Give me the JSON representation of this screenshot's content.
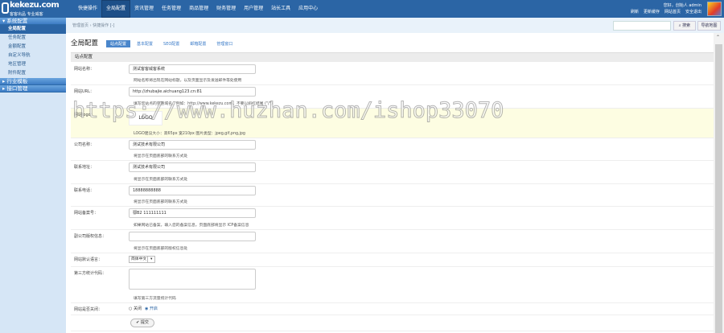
{
  "logo": {
    "name": "kekezu.com",
    "tagline": "客客出品 专业威客"
  },
  "nav": [
    "快捷操作",
    "全局配置",
    "资讯管理",
    "任务管理",
    "商品管理",
    "财务管理",
    "用户管理",
    "站长工具",
    "应用中心"
  ],
  "nav_active": 1,
  "user": {
    "greeting": "您好，创始人 admin",
    "links": [
      "刷新",
      "更新缓存",
      "网站首页",
      "安全退出"
    ]
  },
  "sidebar": {
    "sections": [
      {
        "title": "▾ 系统配置",
        "items": [
          "全局配置",
          "任务配置",
          "金额配置",
          "自定义导航",
          "地区管理",
          "附件配置"
        ]
      },
      {
        "title": "▸ 行业模板",
        "items": []
      },
      {
        "title": "▸ 接口管理",
        "items": []
      }
    ],
    "active_item": "全局配置"
  },
  "breadcrumb": "管理首页 › 快捷操作 [-]",
  "search": {
    "button": "⌕ 搜索",
    "map": "导航地图"
  },
  "page": {
    "title": "全局配置",
    "tabs": [
      "站点配置",
      "基本配置",
      "SEO配置",
      "邮箱配置",
      "管理窗口"
    ],
    "active_tab": 0,
    "section": "站点配置"
  },
  "form": [
    {
      "type": "input",
      "label": "网站名称：",
      "value": "测试客客威客系统",
      "hint": "网站名称将出现在网站标题，以及页面显示及发送邮件等处使用",
      "h": 28
    },
    {
      "type": "input",
      "label": "网站URL：",
      "value": "http://zhubajie.aichuang123.cn:81",
      "hint": "填写您站点的完整域名。例如：http://www.kekezu.com，不要以斜杠结尾 (\"/\")",
      "h": 29
    },
    {
      "type": "logo",
      "label": "网站logo：",
      "value": "LOGO",
      "hint": "LOGO建议大小：高65px 宽210px 图片类型：jpeg,gif,png,jpg",
      "h": 37
    },
    {
      "type": "input",
      "label": "公司名称：",
      "value": "测试技术有限公司",
      "hint": "将显示在页面底部的联系方式处",
      "h": 28
    },
    {
      "type": "input",
      "label": "联系地址：",
      "value": "测试技术有限公司",
      "hint": "将显示在页面底部的联系方式处",
      "h": 29
    },
    {
      "type": "input",
      "label": "联系电话：",
      "value": "18888888888",
      "hint": "将显示在页面底部的联系方式处",
      "h": 28
    },
    {
      "type": "input",
      "label": "网站备案号：",
      "value": "鄂B2 111111111",
      "hint": "如果网站已备案，填入您的备案信息，页面底部将显示 ICP备案信息",
      "h": 29
    },
    {
      "type": "input",
      "label": "副公司版权信息：",
      "value": "",
      "hint": "将显示在页面底部的版权信息处",
      "h": 29
    },
    {
      "type": "select",
      "label": "网站默认语言：",
      "value": "简体中文",
      "h": 17
    },
    {
      "type": "textarea",
      "label": "第三方统计代码：",
      "value": "",
      "hint": "填写第三方流量统计代码",
      "h": 45
    },
    {
      "type": "radio",
      "label": "网站是否关闭：",
      "options": [
        "关闭",
        "开启"
      ],
      "selected": 1,
      "h": 15
    },
    {
      "type": "submit",
      "label": "",
      "value": "✔ 提交",
      "h": 20
    }
  ],
  "watermark": "https://www.huzhan.com/ishop33070"
}
